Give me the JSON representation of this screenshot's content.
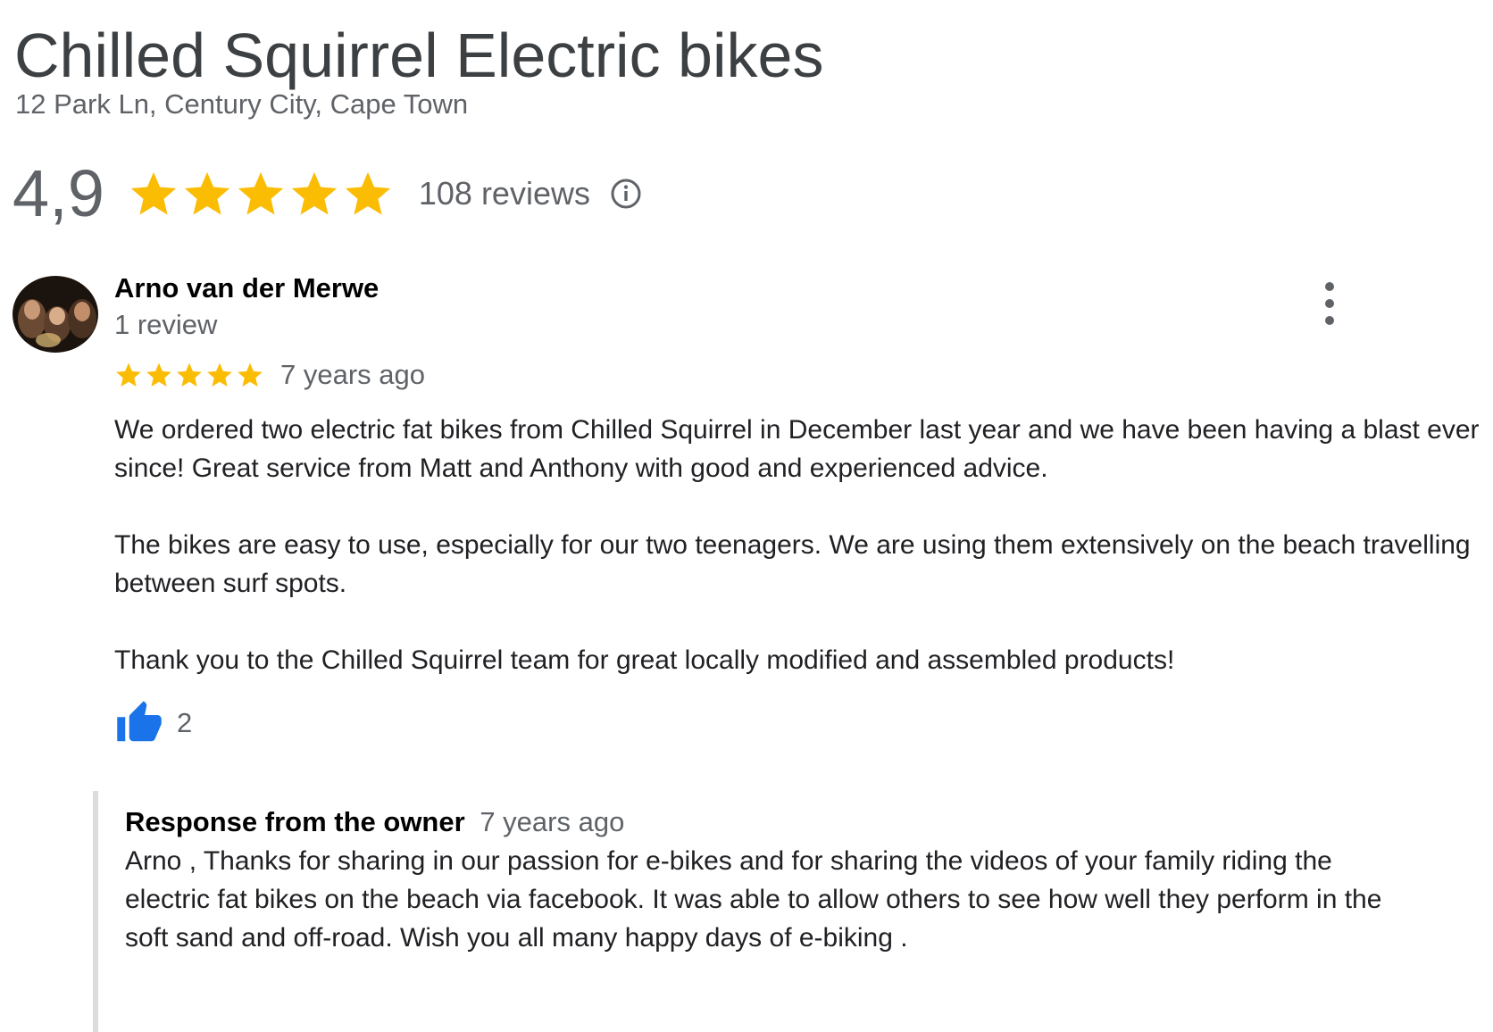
{
  "business": {
    "name": "Chilled Squirrel Electric bikes",
    "address": "12 Park Ln, Century City, Cape Town",
    "rating": "4,9",
    "stars": 5,
    "review_count": "108 reviews",
    "info_icon": "info-icon"
  },
  "review": {
    "author": "Arno van der Merwe",
    "author_meta": "1 review",
    "stars": 5,
    "date": "7 years ago",
    "paragraphs": [
      "We ordered two electric fat bikes from Chilled Squirrel in December last year and we have been having a blast ever since! Great service from Matt and Anthony with good and experienced advice.",
      "The bikes are easy to use, especially for our two teenagers. We are using them extensively on the beach travelling between surf spots.",
      "Thank you to the Chilled Squirrel team for great locally modified and assembled products!"
    ],
    "likes": "2",
    "more_icon": "more-vert-icon",
    "like_icon": "thumbs-up-icon"
  },
  "owner_response": {
    "title": "Response from the owner",
    "date": "7 years ago",
    "text": "Arno , Thanks for sharing in our passion for e-bikes and for sharing the videos of your family riding the electric fat bikes on the beach via facebook. It was able to allow others to see how well they perform in the soft sand and off-road. Wish you all many happy days of e-biking ."
  },
  "colors": {
    "star": "#fbbc04",
    "like": "#1a73e8",
    "muted_text": "#5f6368",
    "response_border": "#dadce0"
  }
}
